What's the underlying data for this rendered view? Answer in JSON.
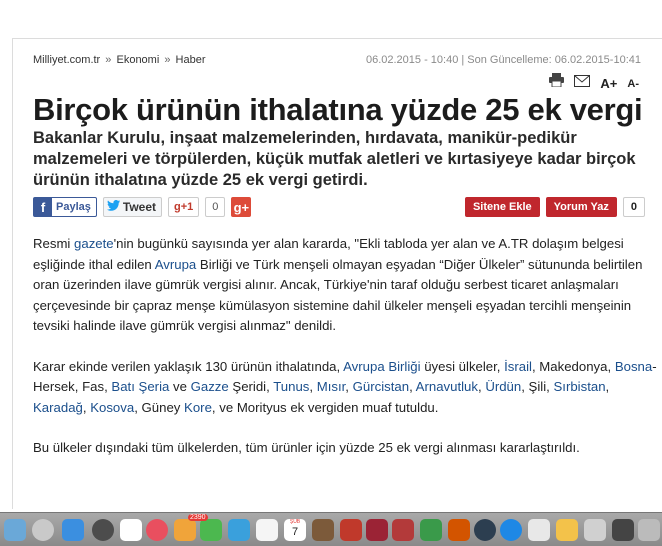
{
  "breadcrumb": [
    "Milliyet.com.tr",
    "Ekonomi",
    "Haber"
  ],
  "breadcrumb_separator": "»",
  "dates": {
    "published": "06.02.2015 - 10:40",
    "divider": "|",
    "updated_label": "Son Güncelleme:",
    "updated": "06.02.2015-10:41"
  },
  "tools": {
    "font_increase": "A+",
    "font_decrease": "A-"
  },
  "headline": "Birçok ürünün ithalatına yüzde 25 ek vergi",
  "subtitle": "Bakanlar Kurulu, inşaat malzemelerinden, hırdavata, manikür-pedikür malzemeleri ve törpülerden, küçük mutfak aletleri ve kırtasiyeye kadar birçok ürünün ithalatına yüzde 25 ek vergi getirdi.",
  "share": {
    "facebook_icon": "f",
    "facebook": "Paylaş",
    "twitter": "Tweet",
    "gplus_one": "g+1",
    "gplus_count": "0",
    "gplus_icon": "g+"
  },
  "actions": {
    "sitene_ekle": "Sitene Ekle",
    "yorum_yaz": "Yorum Yaz",
    "comment_count": "0"
  },
  "p1": {
    "a": "   Resmi ",
    "l1": "gazete",
    "b": "'nin bugünkü sayısında yer alan kararda, \"Ekli tabloda yer alan ve A.TR dolaşım belgesi eşliğinde ithal edilen ",
    "l2": "Avrupa",
    "c": " Birliği ve Türk menşeli olmayan eşyadan “Diğer Ülkeler” sütununda belirtilen oran üzerinden ilave gümrük vergisi alınır. Ancak, Türkiye'nin taraf olduğu serbest ticaret anlaşmaları çerçevesinde bir çapraz menşe kümülasyon sistemine dahil ülkeler menşeli eşyadan tercihli menşeinin tevsiki halinde ilave gümrük vergisi alınmaz\" denildi."
  },
  "p2": {
    "a": "Karar ekinde verilen yaklaşık 130 ürünün ithalatında, ",
    "l1": "Avrupa Birliği",
    "b": " üyesi ülkeler, ",
    "l2": "İsrail",
    "c": ", Makedonya, ",
    "l3": "Bosna",
    "d": "-Hersek, Fas, ",
    "l4": "Batı Şeria",
    "e": " ve ",
    "l5": "Gazze",
    "f": " Şeridi, ",
    "l6": "Tunus",
    "g": ", ",
    "l7": "Mısır",
    "h": ", ",
    "l8": "Gürcistan",
    "i": ", ",
    "l9": "Arnavutluk",
    "j": ", ",
    "l10": "Ürdün",
    "k": ", Şili, ",
    "l11": "Sırbistan",
    "m": ", ",
    "l12": "Karadağ",
    "n": ", ",
    "l13": "Kosova",
    "o": ", Güney ",
    "l14": "Kore",
    "p": ", ve Morityus ek vergiden muaf tutuldu."
  },
  "p3": "Bu ülkeler dışındaki tüm ülkelerden, tüm ürünler için yüzde 25 ek vergi alınması kararlaştırıldı.",
  "dock": {
    "badge": "2390",
    "calendar_month": "ŞUB",
    "calendar_day": "7"
  },
  "colors": {
    "link": "#1b4f8c",
    "red_button": "#c0272d",
    "facebook": "#3b5998",
    "gplus": "#dd4b39"
  }
}
